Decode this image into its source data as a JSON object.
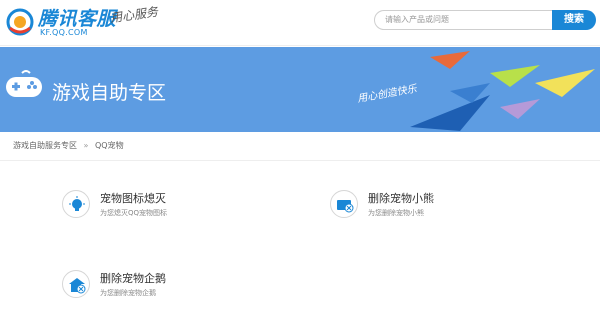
{
  "header": {
    "logo_title": "腾讯客服",
    "logo_sub": "KF.QQ.COM",
    "slogan": "用心服务",
    "search_placeholder": "请输入产品或问题",
    "search_button": "搜索"
  },
  "banner": {
    "title": "游戏自助专区",
    "slogan": "用心创造快乐"
  },
  "breadcrumb": {
    "home": "游戏自助服务专区",
    "separator": "»",
    "current": "QQ宠物"
  },
  "cards": [
    {
      "title": "宠物图标熄灭",
      "desc": "为您熄灭QQ宠物图标",
      "icon": "lightbulb-icon"
    },
    {
      "title": "删除宠物小熊",
      "desc": "为您删除宠物小熊",
      "icon": "delete-card-icon"
    },
    {
      "title": "删除宠物企鹅",
      "desc": "为您删除宠物企鹅",
      "icon": "delete-home-icon"
    }
  ],
  "colors": {
    "brand": "#1a87d6",
    "banner": "#5d9ce2"
  }
}
